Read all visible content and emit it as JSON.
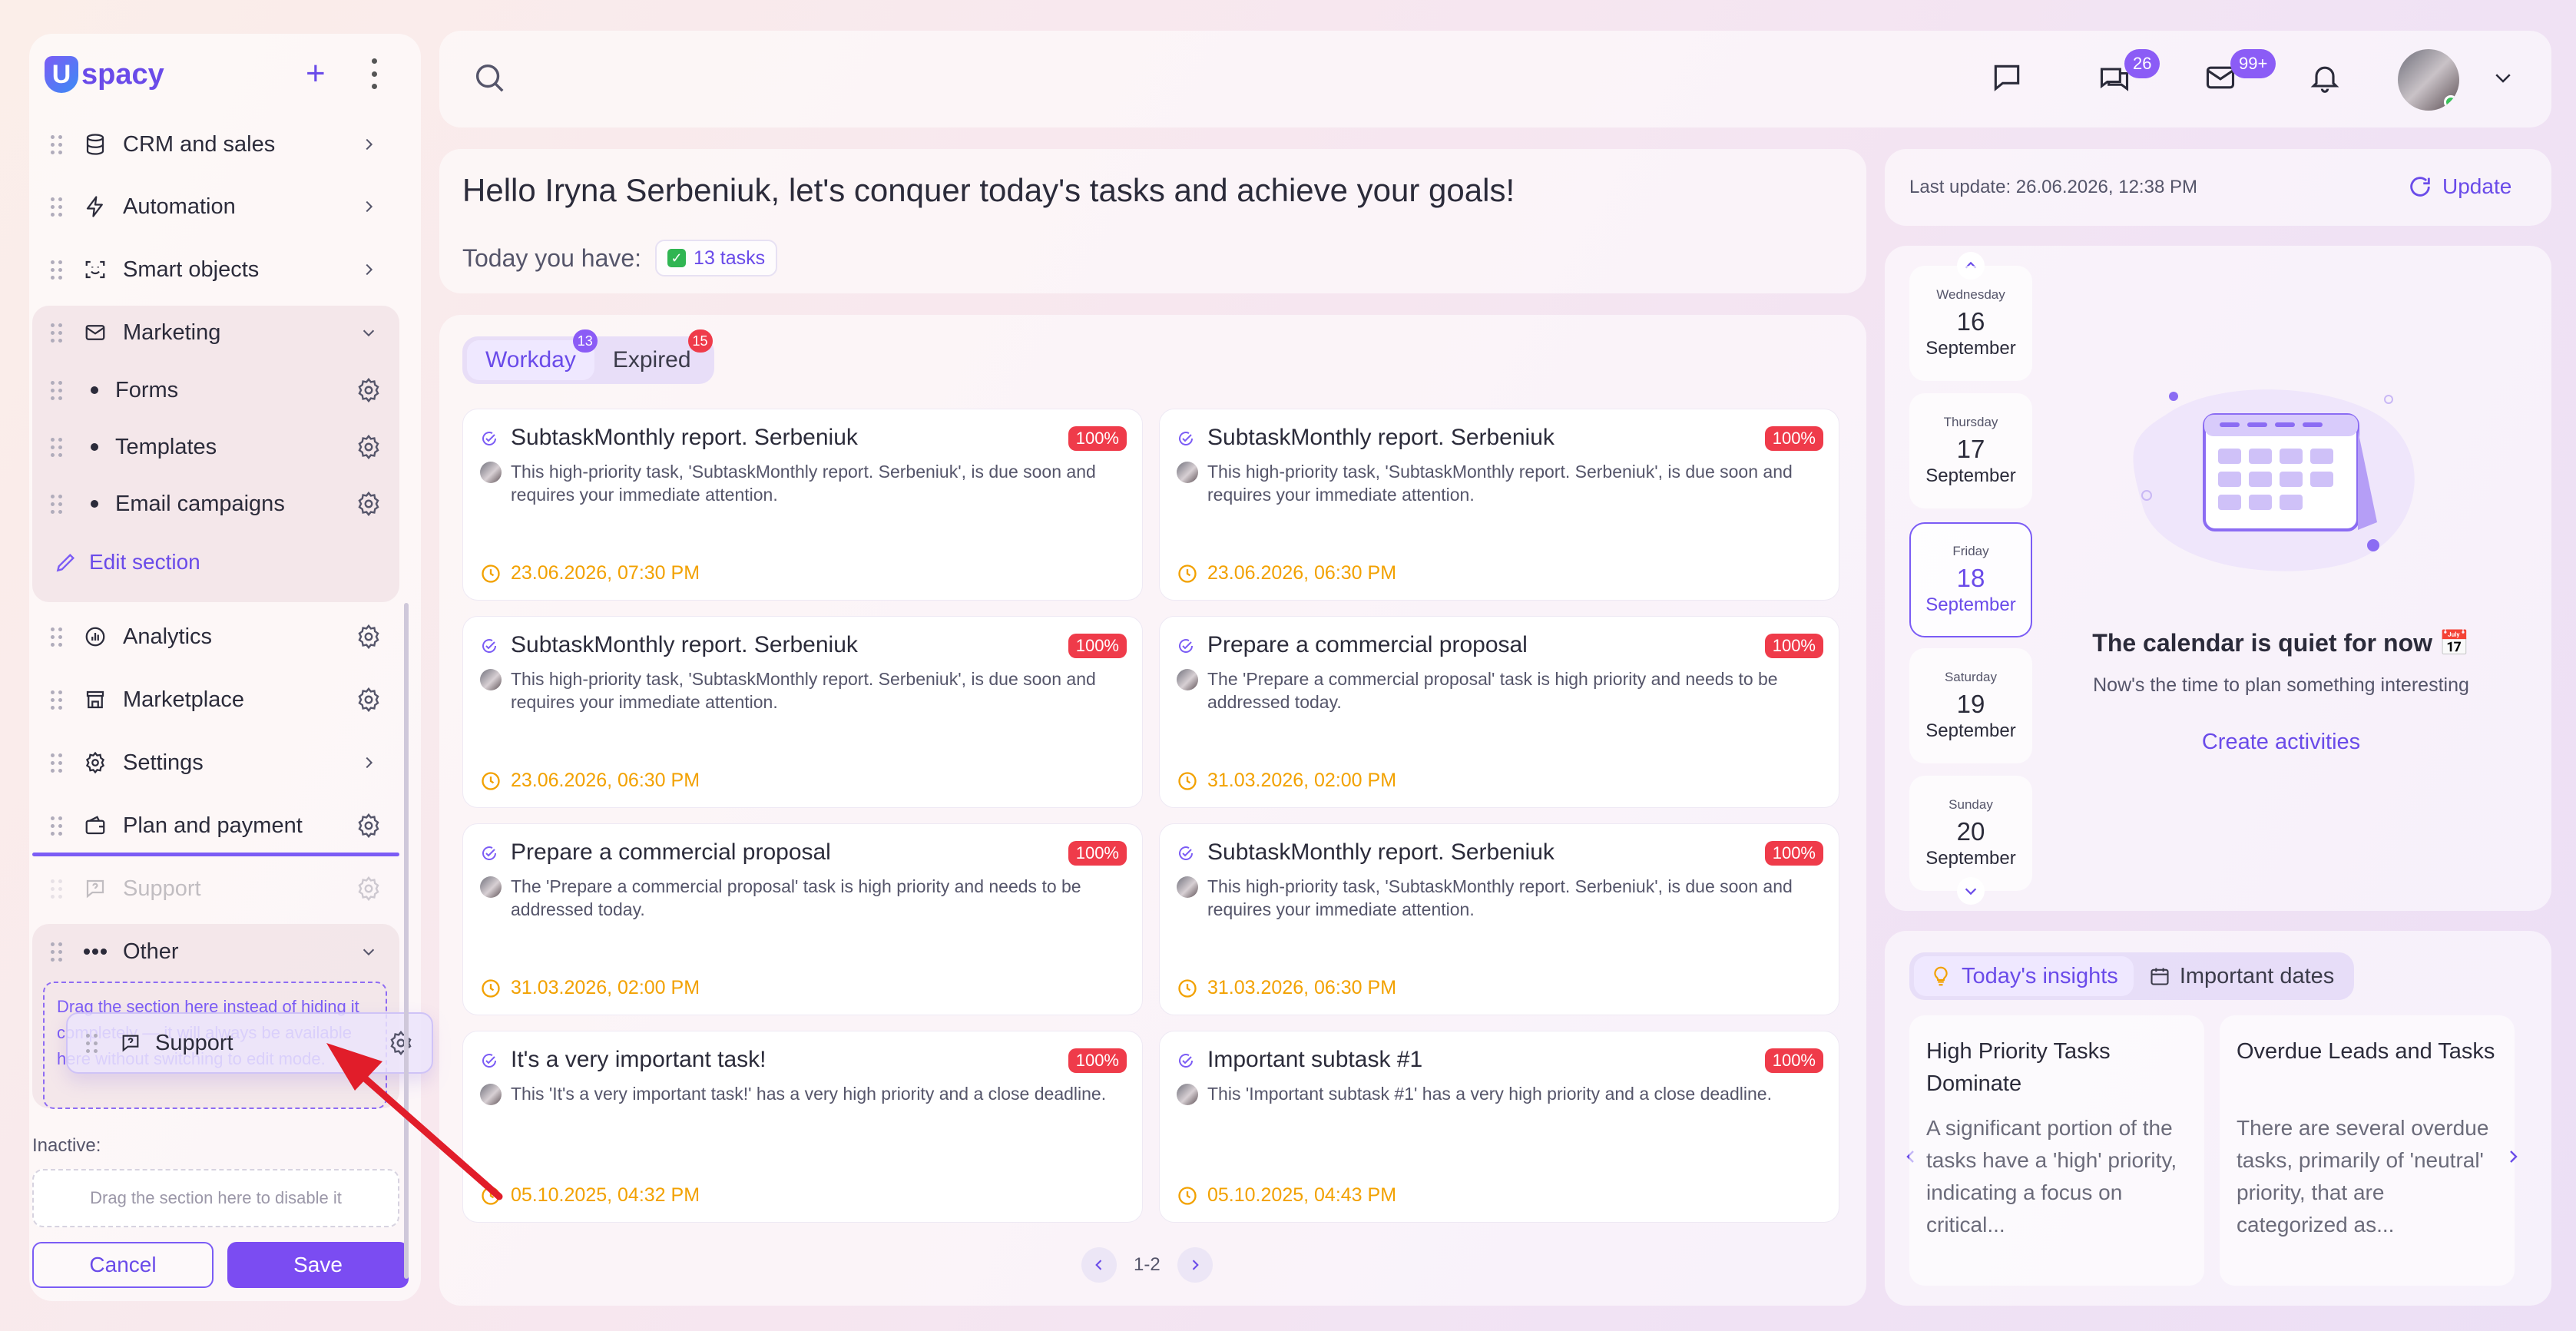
{
  "app": {
    "logo_letter": "U",
    "logo_text": "spacy"
  },
  "sidebar": {
    "items": [
      {
        "label": "CRM and sales",
        "icon": "database-icon"
      },
      {
        "label": "Automation",
        "icon": "lightning-icon"
      },
      {
        "label": "Smart objects",
        "icon": "scan-face-icon"
      },
      {
        "label": "Marketing",
        "icon": "envelope-icon"
      },
      {
        "label": "Forms"
      },
      {
        "label": "Templates"
      },
      {
        "label": "Email campaigns"
      },
      {
        "label": "Analytics",
        "icon": "chart-icon"
      },
      {
        "label": "Marketplace",
        "icon": "store-icon"
      },
      {
        "label": "Settings",
        "icon": "gear-icon"
      },
      {
        "label": "Plan and payment",
        "icon": "wallet-icon"
      },
      {
        "label": "Support",
        "icon": "help-chat-icon"
      },
      {
        "label": "Other",
        "icon": "more-icon"
      }
    ],
    "edit_section": "Edit section",
    "dropzone_text": "Drag the section here instead of hiding it completely — it will always be available here without switching to edit mode.",
    "dragging_label": "Support",
    "inactive_label": "Inactive:",
    "inactive_placeholder": "Drag the section here to disable it",
    "cancel": "Cancel",
    "save": "Save"
  },
  "topbar": {
    "chat_badge": "26",
    "mail_badge": "99+"
  },
  "greeting": {
    "title": "Hello Iryna Serbeniuk, let's conquer today's tasks and achieve your goals!",
    "today_label": "Today you have:",
    "tasks_chip": "13 tasks"
  },
  "tasks": {
    "tabs": [
      {
        "label": "Workday",
        "badge": "13"
      },
      {
        "label": "Expired",
        "badge": "15"
      }
    ],
    "cards": [
      {
        "title": "SubtaskMonthly report. Serbeniuk",
        "pct": "100%",
        "desc": "This high-priority task, 'SubtaskMonthly report. Serbeniuk', is due soon and requires your immediate attention.",
        "date": "23.06.2026, 07:30 PM"
      },
      {
        "title": "SubtaskMonthly report. Serbeniuk",
        "pct": "100%",
        "desc": "This high-priority task, 'SubtaskMonthly report. Serbeniuk', is due soon and requires your immediate attention.",
        "date": "23.06.2026, 06:30 PM"
      },
      {
        "title": "SubtaskMonthly report. Serbeniuk",
        "pct": "100%",
        "desc": "This high-priority task, 'SubtaskMonthly report. Serbeniuk', is due soon and requires your immediate attention.",
        "date": "23.06.2026, 06:30 PM"
      },
      {
        "title": "Prepare a commercial proposal",
        "pct": "100%",
        "desc": "The 'Prepare a commercial proposal' task is high priority and needs to be addressed today.",
        "date": "31.03.2026, 02:00 PM"
      },
      {
        "title": "Prepare a commercial proposal",
        "pct": "100%",
        "desc": "The 'Prepare a commercial proposal' task is high priority and needs to be addressed today.",
        "date": "31.03.2026, 02:00 PM"
      },
      {
        "title": "SubtaskMonthly report. Serbeniuk",
        "pct": "100%",
        "desc": "This high-priority task, 'SubtaskMonthly report. Serbeniuk', is due soon and requires your immediate attention.",
        "date": "31.03.2026, 06:30 PM"
      },
      {
        "title": "It's a very important task!",
        "pct": "100%",
        "desc": "This 'It's a very important task!' has a very high priority and a close deadline.",
        "date": "05.10.2025, 04:32 PM"
      },
      {
        "title": "Important subtask #1",
        "pct": "100%",
        "desc": "This 'Important subtask #1' has a very high priority and a close deadline.",
        "date": "05.10.2025, 04:43 PM"
      }
    ],
    "pager": "1-2"
  },
  "right": {
    "last_update": "Last update: 26.06.2026, 12:38 PM",
    "update": "Update",
    "days": [
      {
        "weekday": "Wednesday",
        "day": "16",
        "month": "September"
      },
      {
        "weekday": "Thursday",
        "day": "17",
        "month": "September"
      },
      {
        "weekday": "Friday",
        "day": "18",
        "month": "September"
      },
      {
        "weekday": "Saturday",
        "day": "19",
        "month": "September"
      },
      {
        "weekday": "Sunday",
        "day": "20",
        "month": "September"
      }
    ],
    "quiet_title": "The calendar is quiet for now 📅",
    "quiet_sub": "Now's the time to plan something interesting",
    "create": "Create activities",
    "insight_tabs": [
      "Today's insights",
      "Important dates"
    ],
    "insights": [
      {
        "title": "High Priority Tasks Dominate",
        "body": "A significant portion of the tasks have a 'high' priority, indicating a focus on critical..."
      },
      {
        "title": "Overdue Leads and Tasks",
        "body": "There are several overdue tasks, primarily of 'neutral' priority, that are categorized as..."
      }
    ]
  },
  "colors": {
    "accent": "#7b4cf2",
    "danger": "#ef3b4a",
    "warning": "#f2a100",
    "success": "#30b552"
  }
}
